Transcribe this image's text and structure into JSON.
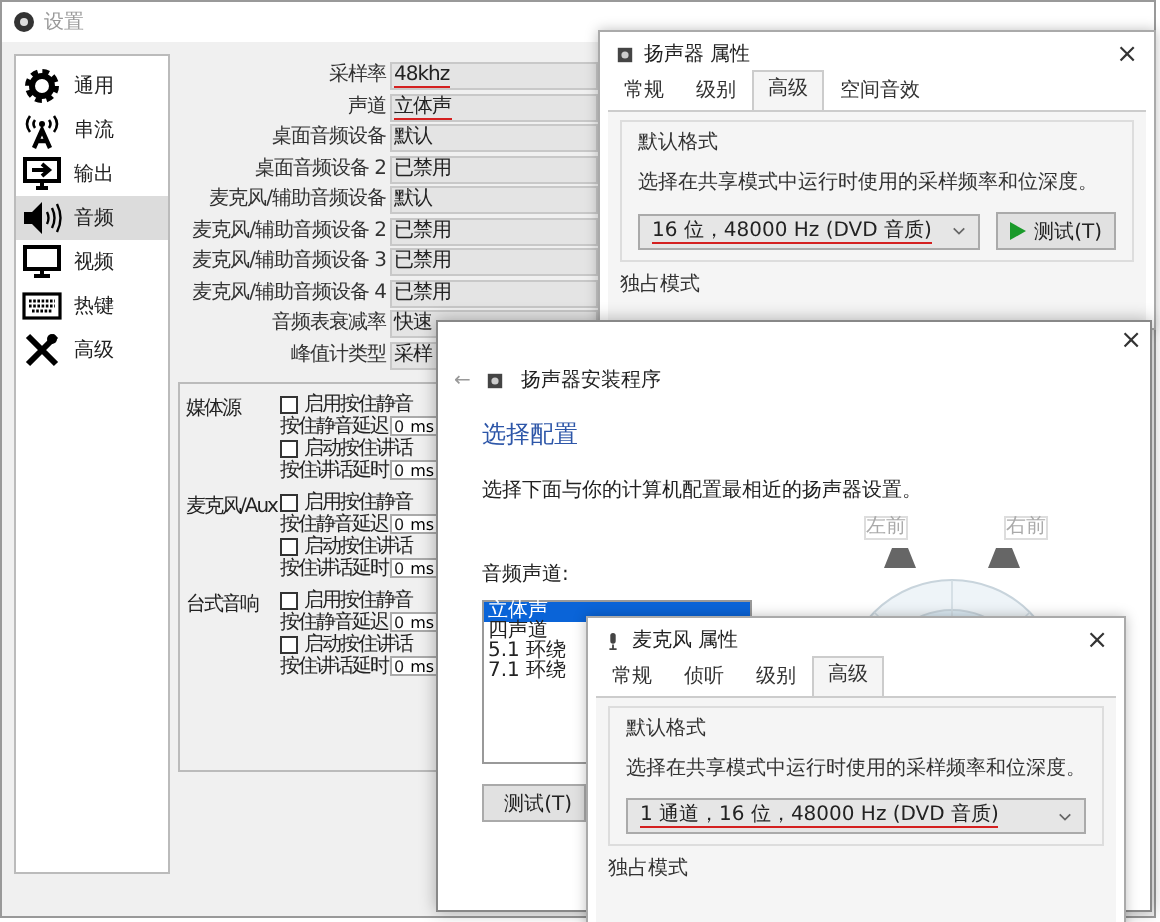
{
  "settings_window": {
    "title": "设置",
    "sidebar": [
      {
        "kind": "gear",
        "label": "通用",
        "selected": false
      },
      {
        "kind": "antenna",
        "label": "串流",
        "selected": false
      },
      {
        "kind": "output",
        "label": "输出",
        "selected": false
      },
      {
        "kind": "speaker",
        "label": "音频",
        "selected": true
      },
      {
        "kind": "monitor",
        "label": "视频",
        "selected": false
      },
      {
        "kind": "keyboard",
        "label": "热键",
        "selected": false
      },
      {
        "kind": "tools",
        "label": "高级",
        "selected": false
      }
    ],
    "fields": [
      {
        "label": "采样率",
        "value": "48khz",
        "annotated": true
      },
      {
        "label": "声道",
        "value": "立体声",
        "annotated": true
      },
      {
        "label": "桌面音频设备",
        "value": "默认",
        "annotated": false
      },
      {
        "label": "桌面音频设备 2",
        "value": "已禁用",
        "annotated": false
      },
      {
        "label": "麦克风/辅助音频设备",
        "value": "默认",
        "annotated": false
      },
      {
        "label": "麦克风/辅助音频设备 2",
        "value": "已禁用",
        "annotated": false
      },
      {
        "label": "麦克风/辅助音频设备 3",
        "value": "已禁用",
        "annotated": false
      },
      {
        "label": "麦克风/辅助音频设备 4",
        "value": "已禁用",
        "annotated": false
      },
      {
        "label": "音频表衰减率",
        "value": "快速",
        "annotated": false
      },
      {
        "label": "峰值计类型",
        "value": "采样",
        "annotated": false
      }
    ],
    "hotkey_groups": [
      {
        "source": "媒体源",
        "rows": [
          {
            "kind": "checkbox",
            "label": "启用按住静音",
            "checked": false
          },
          {
            "kind": "delay",
            "label": "按住静音延迟",
            "value": "0",
            "unit": "ms"
          },
          {
            "kind": "checkbox",
            "label": "启动按住讲话",
            "checked": false
          },
          {
            "kind": "delay",
            "label": "按住讲话延时",
            "value": "0",
            "unit": "ms"
          }
        ]
      },
      {
        "source": "麦克风/Aux",
        "rows": [
          {
            "kind": "checkbox",
            "label": "启用按住静音",
            "checked": false
          },
          {
            "kind": "delay",
            "label": "按住静音延迟",
            "value": "0",
            "unit": "ms"
          },
          {
            "kind": "checkbox",
            "label": "启动按住讲话",
            "checked": false
          },
          {
            "kind": "delay",
            "label": "按住讲话延时",
            "value": "0",
            "unit": "ms"
          }
        ]
      },
      {
        "source": "台式音响",
        "rows": [
          {
            "kind": "checkbox",
            "label": "启用按住静音",
            "checked": false
          },
          {
            "kind": "delay",
            "label": "按住静音延迟",
            "value": "0",
            "unit": "ms"
          },
          {
            "kind": "checkbox",
            "label": "启动按住讲话",
            "checked": false
          },
          {
            "kind": "delay",
            "label": "按住讲话延时",
            "value": "0",
            "unit": "ms"
          }
        ]
      }
    ]
  },
  "speaker_properties": {
    "title": "扬声器 属性",
    "close": "×",
    "tabs": [
      {
        "label": "常规",
        "selected": false
      },
      {
        "label": "级别",
        "selected": false
      },
      {
        "label": "高级",
        "selected": true
      },
      {
        "label": "空间音效",
        "selected": false
      }
    ],
    "group_title": "默认格式",
    "description": "选择在共享模式中运行时使用的采样频率和位深度。",
    "format": "16 位，48000 Hz (DVD 音质)",
    "format_annotated": true,
    "test_button": "测试(T)",
    "next_group": "独占模式"
  },
  "speaker_setup": {
    "close": "×",
    "back": "←",
    "title": "扬声器安装程序",
    "heading": "选择配置",
    "description": "选择下面与你的计算机配置最相近的扬声器设置。",
    "channels_label": "音频声道:",
    "channels": [
      {
        "label": "立体声",
        "selected": true
      },
      {
        "label": "四声道",
        "selected": false
      },
      {
        "label": "5.1 环绕",
        "selected": false
      },
      {
        "label": "7.1 环绕",
        "selected": false
      }
    ],
    "test_button": "测试(T)",
    "speaker_labels": [
      "左前",
      "右前"
    ]
  },
  "mic_properties": {
    "title": "麦克风 属性",
    "close": "×",
    "tabs": [
      {
        "label": "常规",
        "selected": false
      },
      {
        "label": "侦听",
        "selected": false
      },
      {
        "label": "级别",
        "selected": false
      },
      {
        "label": "高级",
        "selected": true
      }
    ],
    "group_title": "默认格式",
    "description": "选择在共享模式中运行时使用的采样频率和位深度。",
    "format": "1 通道，16 位，48000 Hz (DVD 音质)",
    "format_annotated": true,
    "next_group": "独占模式"
  }
}
